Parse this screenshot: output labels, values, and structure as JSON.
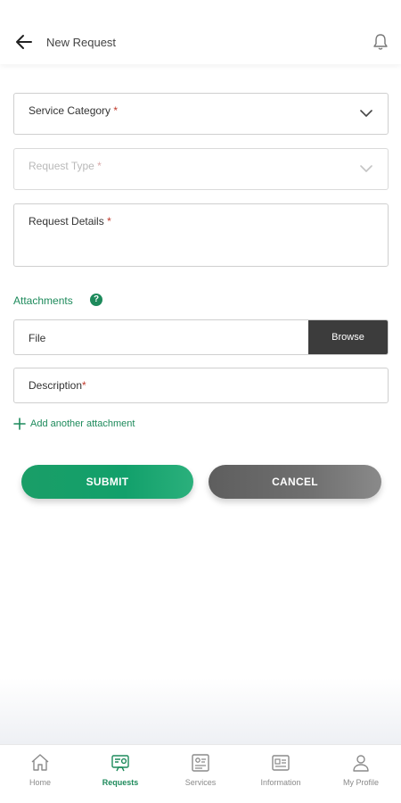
{
  "header": {
    "title": "New Request",
    "back_icon": "arrow-left-icon",
    "notification_icon": "bell-icon"
  },
  "form": {
    "service_category": {
      "label": "Service Category",
      "required_mark": "*"
    },
    "request_type": {
      "label": "Request Type",
      "required_mark": "*",
      "disabled": true
    },
    "request_details": {
      "label": "Request Details",
      "required_mark": "*"
    },
    "attachments": {
      "title": "Attachments",
      "help_icon": "?",
      "file_label": "File",
      "browse_label": "Browse",
      "description_label": "Description",
      "description_required_mark": "*",
      "add_another_label": "Add another attachment"
    }
  },
  "actions": {
    "submit_label": "SUBMIT",
    "cancel_label": "CANCEL"
  },
  "colors": {
    "accent": "#1d8a5b",
    "submit": "#12a06b",
    "cancel": "#6a6a6a",
    "browse": "#3c3c3c",
    "required": "#c0392b"
  },
  "tabbar": {
    "active": "Requests",
    "items": [
      {
        "label": "Home",
        "icon": "home-icon"
      },
      {
        "label": "Requests",
        "icon": "requests-icon"
      },
      {
        "label": "Services",
        "icon": "services-icon"
      },
      {
        "label": "Information",
        "icon": "information-icon"
      },
      {
        "label": "My Profile",
        "icon": "profile-icon"
      }
    ]
  }
}
